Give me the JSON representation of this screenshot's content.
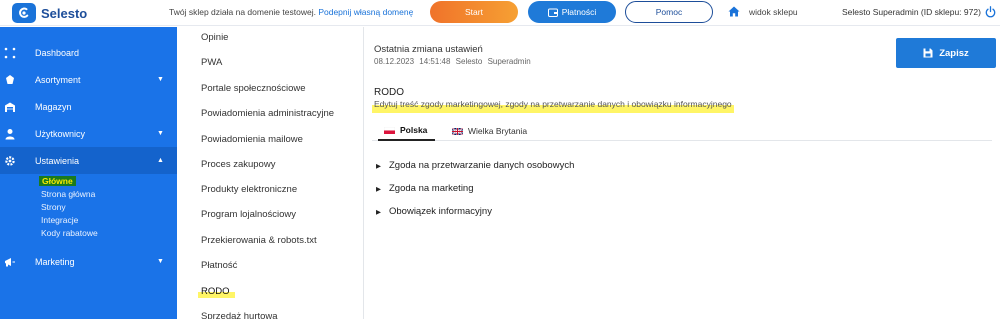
{
  "brand": {
    "name": "Selesto"
  },
  "topbar": {
    "message": "Twój sklep działa na domenie testowej.",
    "message_link": "Podepnij własną domenę",
    "start_label": "Start",
    "payments_label": "Płatności",
    "help_label": "Pomoc",
    "store_view_label": "widok sklepu",
    "admin_label": "Selesto Superadmin (ID sklepu: 972)"
  },
  "sidebar": {
    "items": [
      {
        "label": "Dashboard",
        "icon": "grid-icon"
      },
      {
        "label": "Asortyment",
        "icon": "tag-icon"
      },
      {
        "label": "Magazyn",
        "icon": "warehouse-icon"
      },
      {
        "label": "Użytkownicy",
        "icon": "user-icon"
      },
      {
        "label": "Ustawienia",
        "icon": "gear-icon"
      },
      {
        "label": "Marketing",
        "icon": "megaphone-icon"
      }
    ],
    "sub_items": [
      "Główne",
      "Strona główna",
      "Strony",
      "Integracje",
      "Kody rabatowe"
    ]
  },
  "settings_menu": {
    "items": [
      "Opinie",
      "PWA",
      "Portale społecznościowe",
      "Powiadomienia administracyjne",
      "Powiadomienia mailowe",
      "Proces zakupowy",
      "Produkty elektroniczne",
      "Program lojalnościowy",
      "Przekierowania & robots.txt",
      "Płatność",
      "RODO",
      "Sprzedaż hurtowa"
    ],
    "active": "RODO"
  },
  "content": {
    "last_change_label": "Ostatnia zmiana ustawień",
    "last_change_date": "08.12.2023",
    "last_change_time": "14:51:48",
    "last_change_user": "Selesto Superadmin",
    "save_label": "Zapisz",
    "section_title": "RODO",
    "section_description": "Edytuj treść zgody marketingowej, zgody na przetwarzanie danych i obowiązku informacyjnego",
    "tabs": [
      "Polska",
      "Wielka Brytania"
    ],
    "accordions": [
      "Zgoda na przetwarzanie danych osobowych",
      "Zgoda na marketing",
      "Obowiązek informacyjny"
    ]
  },
  "colors": {
    "primary": "#1a73e8",
    "accent_orange": "#f0732a",
    "highlight": "#fff566",
    "active_sub_bg": "#1a7a1e"
  }
}
